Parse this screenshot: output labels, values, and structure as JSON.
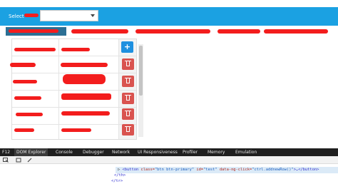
{
  "header": {
    "select_label": "Select",
    "select_value": ""
  },
  "grid": {
    "add_button_label": "+",
    "row_count": 6
  },
  "devtools": {
    "tabs": [
      "F12",
      "DOM Explorer",
      "Console",
      "Debugger",
      "Network",
      "UI Responsiveness",
      "Profiler",
      "Memory",
      "Emulation"
    ],
    "code_lines": {
      "line1_prefix": "▷ ",
      "line1_tag_open": "<button",
      "line1_attr1": " class=",
      "line1_val1": "\"btn btn-primary\"",
      "line1_attr2": " id=",
      "line1_val2": "\"test\"",
      "line1_attr3": " data-ng-click=",
      "line1_val3": "\"ctrl.addnewRow()\"",
      "line1_tail": ">…</button>",
      "line2": "</th>",
      "line3": "</tr>"
    }
  },
  "colors": {
    "topbar": "#1ba1e2",
    "redaction": "#f31d1d",
    "add_button": "#1e90e0",
    "delete_button": "#d9534f"
  }
}
